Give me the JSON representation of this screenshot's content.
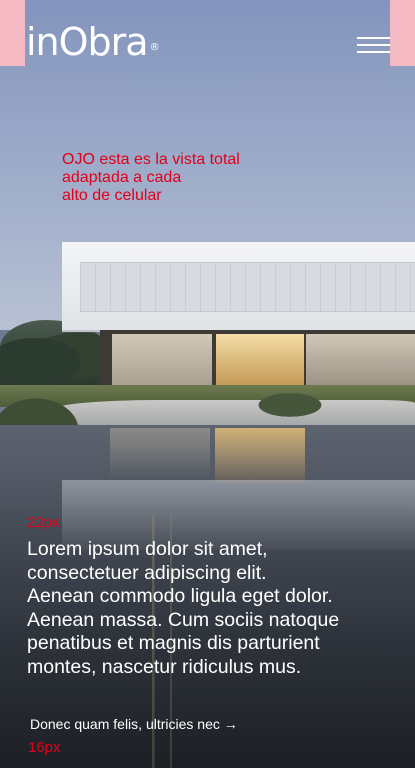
{
  "header": {
    "logo_text": "inObra",
    "logo_mark": "®",
    "menu_icon": "hamburger-menu-icon"
  },
  "annotations": {
    "viewport_note_lines": [
      "OJO esta es la vista total",
      "adaptada a cada",
      "alto de celular"
    ],
    "headline_size_label": "22px",
    "link_size_label": "16px"
  },
  "hero": {
    "headline_lines": [
      "Lorem ipsum dolor sit amet,",
      "consectetuer adipiscing elit.",
      "Aenean commodo ligula eget dolor.",
      "Aenean massa. Cum sociis natoque",
      "penatibus et magnis dis parturient",
      "montes, nascetur ridiculus mus."
    ],
    "link_text": "Donec quam felis, ultricies nec →"
  },
  "colors": {
    "annotation": "#e2001a",
    "marker": "#f5b9c4",
    "text": "#ffffff"
  }
}
